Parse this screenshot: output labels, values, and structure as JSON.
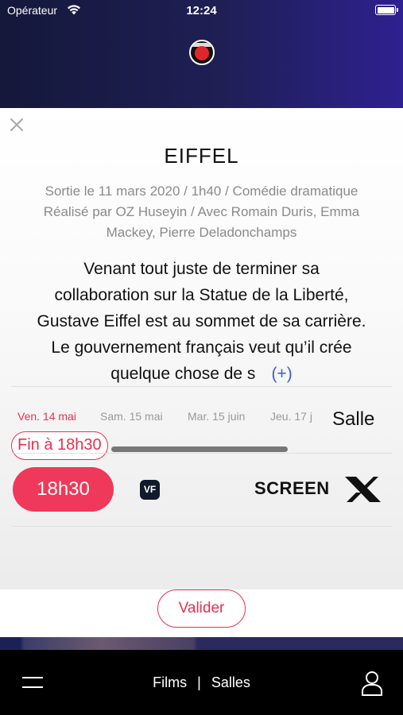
{
  "status_bar": {
    "carrier": "Opérateur",
    "time": "12:24",
    "battery_level": 1.0
  },
  "film": {
    "title": "EIFFEL",
    "meta_line1": "Sortie le 11 mars 2020 / 1h40 / Comédie dramatique",
    "meta_line2": "Réalisé par OZ Huseyin / Avec Romain Duris, Emma",
    "meta_line3": "Mackey, Pierre Deladonchamps",
    "synopsis_line1": "Venant tout juste de terminer sa",
    "synopsis_line2": "collaboration sur la Statue de la Liberté,",
    "synopsis_line3": "Gustave Eiffel est au sommet de sa carrière.",
    "synopsis_line4": "Le gouvernement français veut qu’il crée",
    "synopsis_line5": "quelque chose de s",
    "more_label": "(+)"
  },
  "dates": [
    {
      "label": "Ven. 14 mai",
      "active": true
    },
    {
      "label": "Sam. 15 mai",
      "active": false
    },
    {
      "label": "Mar. 15 juin",
      "active": false
    },
    {
      "label": "Jeu. 17 j",
      "active": false
    }
  ],
  "salle_label": "Salle",
  "end_time_label": "Fin à 18h30",
  "showtime": {
    "time": "18h30",
    "version": "VF",
    "format": "SCREENX"
  },
  "accent_color": "#e8314f",
  "confirm_label": "Valider",
  "tab_bar": {
    "films": "Films",
    "separator": "|",
    "salles": "Salles"
  },
  "icons": [
    "wifi-icon",
    "battery-icon",
    "close-icon",
    "menu-icon",
    "user-icon"
  ]
}
